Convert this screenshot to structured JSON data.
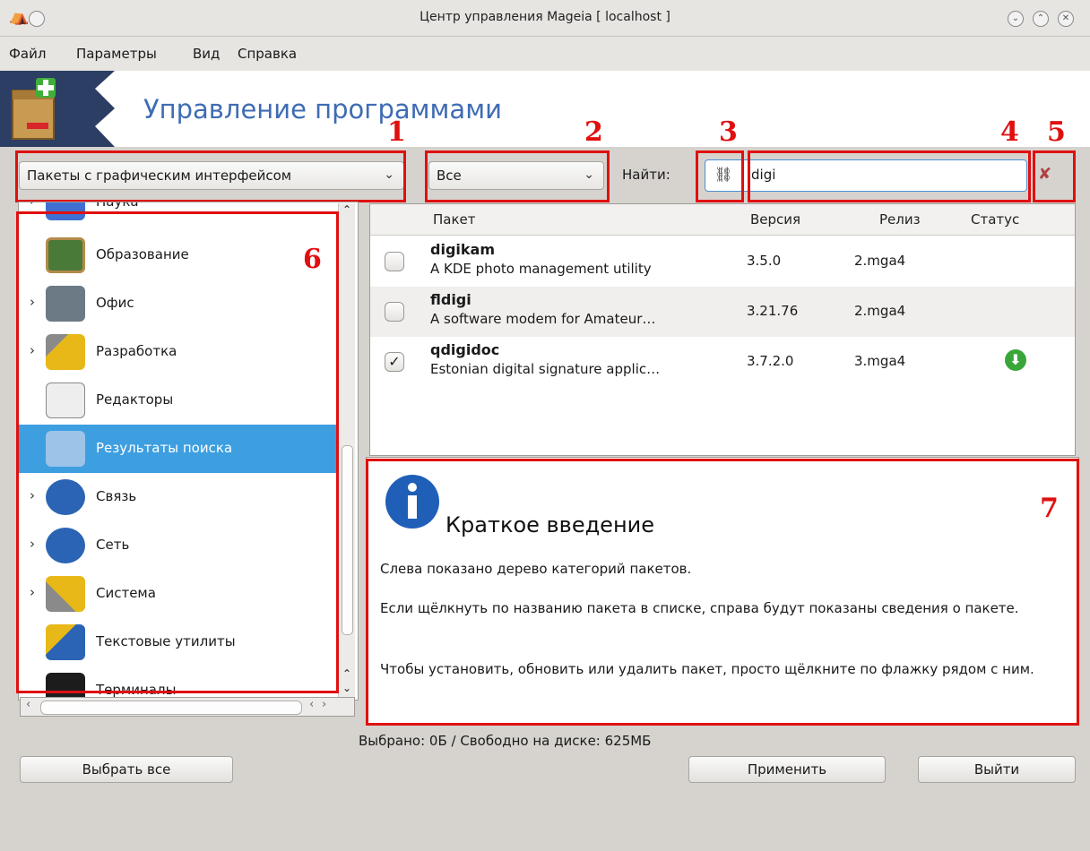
{
  "window": {
    "title": "Центр управления Mageia  [ localhost ]"
  },
  "menubar": [
    "Файл",
    "Параметры",
    "Вид",
    "Справка"
  ],
  "banner": {
    "title": "Управление программами"
  },
  "filters": {
    "category_filter": "Пакеты с графическим интерфейсом",
    "state_filter": "Все",
    "search_label": "Найти:",
    "search_value": "digi"
  },
  "callouts": [
    "1",
    "2",
    "3",
    "4",
    "5",
    "6",
    "7"
  ],
  "tree": {
    "items": [
      {
        "label": "Наука",
        "icon": "science-flask-icon",
        "expandable": true
      },
      {
        "label": "Образование",
        "icon": "education-chalkboard-icon",
        "expandable": false
      },
      {
        "label": "Офис",
        "icon": "office-typewriter-icon",
        "expandable": true
      },
      {
        "label": "Разработка",
        "icon": "development-hammer-icon",
        "expandable": true
      },
      {
        "label": "Редакторы",
        "icon": "editor-pencil-icon",
        "expandable": false
      },
      {
        "label": "Результаты поиска",
        "icon": "search-results-icon",
        "expandable": false,
        "selected": true
      },
      {
        "label": "Связь",
        "icon": "communication-globe-icon",
        "expandable": true
      },
      {
        "label": "Сеть",
        "icon": "network-globe-icon",
        "expandable": true
      },
      {
        "label": "Система",
        "icon": "system-tools-icon",
        "expandable": true
      },
      {
        "label": "Текстовые утилиты",
        "icon": "text-utilities-icon",
        "expandable": false
      },
      {
        "label": "Терминалы",
        "icon": "terminal-icon",
        "expandable": false
      }
    ]
  },
  "table": {
    "headers": [
      "Пакет",
      "Версия",
      "Релиз",
      "Статус"
    ],
    "rows": [
      {
        "name": "digikam",
        "desc": "A KDE photo management utility",
        "version": "3.5.0",
        "release": "2.mga4",
        "checked": false,
        "status": ""
      },
      {
        "name": "fldigi",
        "desc": "A software modem for Amateur…",
        "version": "3.21.76",
        "release": "2.mga4",
        "checked": false,
        "status": ""
      },
      {
        "name": "qdigidoc",
        "desc": "Estonian digital signature applic…",
        "version": "3.7.2.0",
        "release": "3.mga4",
        "checked": true,
        "status": "to-install-icon"
      }
    ]
  },
  "info": {
    "title": "Краткое введение",
    "paragraphs": [
      "Слева показано дерево категорий пакетов.",
      "Если щёлкнуть по названию пакета в списке, справа будут показаны сведения о пакете.",
      "Чтобы установить, обновить или удалить пакет, просто щёлкните по флажку рядом с ним."
    ]
  },
  "status": {
    "text": "Выбрано: 0Б / Свободно на диске: 625МБ"
  },
  "buttons": {
    "select_all": "Выбрать все",
    "apply": "Применить",
    "quit": "Выйти"
  },
  "colors": {
    "highlight": "#e01010",
    "selection": "#3d9ee0",
    "banner_text": "#3f6cb3",
    "banner_dark": "#2c3e63"
  }
}
